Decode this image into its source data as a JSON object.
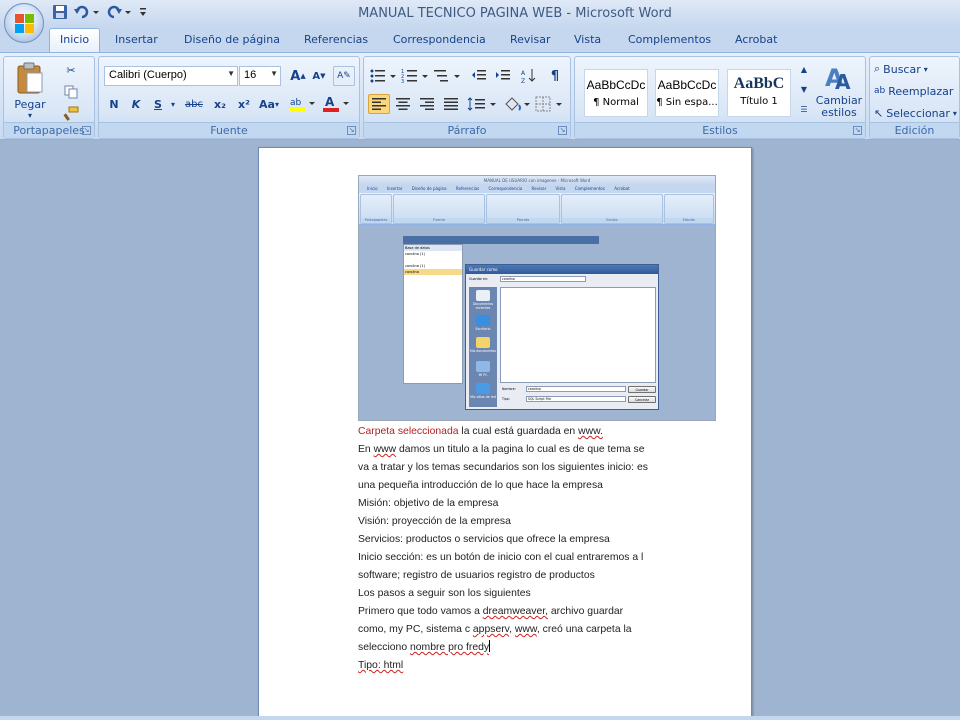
{
  "window": {
    "title": "MANUAL TECNICO PAGINA WEB - Microsoft Word"
  },
  "ribbon_tabs": [
    "Inicio",
    "Insertar",
    "Diseño de página",
    "Referencias",
    "Correspondencia",
    "Revisar",
    "Vista",
    "Complementos",
    "Acrobat"
  ],
  "active_tab": "Inicio",
  "clipboard": {
    "paste_label": "Pegar",
    "group_label": "Portapapeles"
  },
  "font": {
    "font_name": "Calibri (Cuerpo)",
    "font_size": "16",
    "group_label": "Fuente",
    "bold": "N",
    "italic": "K",
    "underline": "S",
    "strike": "abc",
    "subscript": "x₂",
    "superscript": "x²",
    "change_case": "Aa",
    "grow": "A",
    "shrink": "A"
  },
  "paragraph": {
    "group_label": "Párrafo"
  },
  "styles": {
    "group_label": "Estilos",
    "items": [
      {
        "sample": "AaBbCcDc",
        "name": "¶ Normal"
      },
      {
        "sample": "AaBbCcDc",
        "name": "¶ Sin espa..."
      },
      {
        "sample": "AaBbC",
        "name": "Título 1"
      }
    ],
    "change_styles": "Cambiar estilos"
  },
  "editing": {
    "group_label": "Edición",
    "find": "Buscar",
    "replace": "Reemplazar",
    "select": "Seleccionar"
  },
  "embedded_screenshot": {
    "title": "MANUAL DE USUARIO con imagenes - Microsoft Word",
    "tabs": [
      "Inicio",
      "Insertar",
      "Diseño de página",
      "Referencias",
      "Correspondencia",
      "Revisar",
      "Vista",
      "Complementos",
      "Acrobat"
    ],
    "groups": [
      "Portapapeles",
      "Fuente",
      "Párrafo",
      "Estilos",
      "Edición"
    ],
    "left_panel_header": "Base de datos",
    "left_panel_items": [
      "carolina (1)",
      "carolina (1)",
      "carolina"
    ],
    "dialog": {
      "title": "Guardar como",
      "save_in_label": "Guardar en:",
      "save_in_value": "carolina",
      "places": [
        "Documentos recientes",
        "Escritorio",
        "Mis documentos",
        "Mi PC",
        "Mis sitios de red"
      ],
      "name_label": "Nombre:",
      "name_value": "carolina",
      "type_label": "Tipo:",
      "type_value": "SQL Script File",
      "save_button": "Guardar",
      "cancel_button": "Cancelar"
    }
  },
  "document": {
    "line1_red": "Carpeta seleccionada",
    "line1_rest_a": "  la cual está  guardada en ",
    "line1_wavy": "www.",
    "line2_a": "En ",
    "line2_wavy": "www",
    "line2_b": " damos un titulo a la pagina lo cual es de  que tema se",
    "line3": "va a tratar y los temas secundarios son los siguientes inicio: es",
    "line4": "una pequeña introducción de lo que hace la empresa",
    "line5": "Misión: objetivo de la empresa",
    "line6": "Visión: proyección de la empresa",
    "line7": "Servicios: productos o servicios que ofrece la empresa",
    "line8": "Inicio sección: es un botón de inicio con el cual entraremos a l",
    "line9": "software; registro de usuarios registro de productos",
    "line10": "Los pasos a seguir son los siguientes",
    "line11_a": "Primero que todo vamos a ",
    "line11_wavy": "dreamweaver,",
    "line11_b": " archivo guardar",
    "line12_a": "como,  my PC, sistema c ",
    "line12_wavy1": "appserv",
    "line12_b": ", ",
    "line12_wavy2": "www",
    "line12_c": ",  creó una carpeta  la",
    "line13_a": "selecciono  ",
    "line13_wavy": "nombre pro  fredy",
    "line14_wavy": "Tipo: html"
  }
}
